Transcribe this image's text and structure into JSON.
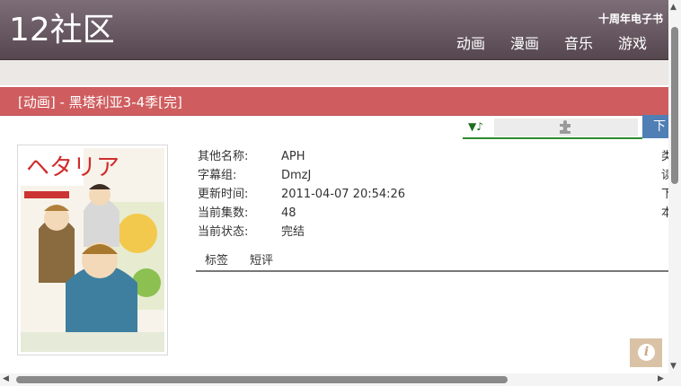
{
  "header": {
    "logo": "12社区",
    "anniversary": "十周年电子书",
    "nav": [
      "动画",
      "漫画",
      "音乐",
      "游戏"
    ]
  },
  "title": "[动画] - 黑塔利亚3-4季[完]",
  "player": {
    "icon": "music-note-icon",
    "plugin_icon": "puzzle-icon",
    "download_label": "下"
  },
  "info": [
    {
      "key": "其他名称:",
      "value": "APH"
    },
    {
      "key": "字幕组:",
      "value": "DmzJ"
    },
    {
      "key": "更新时间:",
      "value": "2011-04-07 20:54:26"
    },
    {
      "key": "当前集数:",
      "value": "48"
    },
    {
      "key": "当前状态:",
      "value": "完结"
    }
  ],
  "side_info": [
    "类",
    "读",
    "下",
    "本"
  ],
  "tabs": [
    "标签",
    "短评"
  ],
  "colors": {
    "header": "#6a5a63",
    "titlebar": "#cf5d5f",
    "accent_green": "#2f8a2f",
    "download_blue": "#4f7fb5"
  }
}
